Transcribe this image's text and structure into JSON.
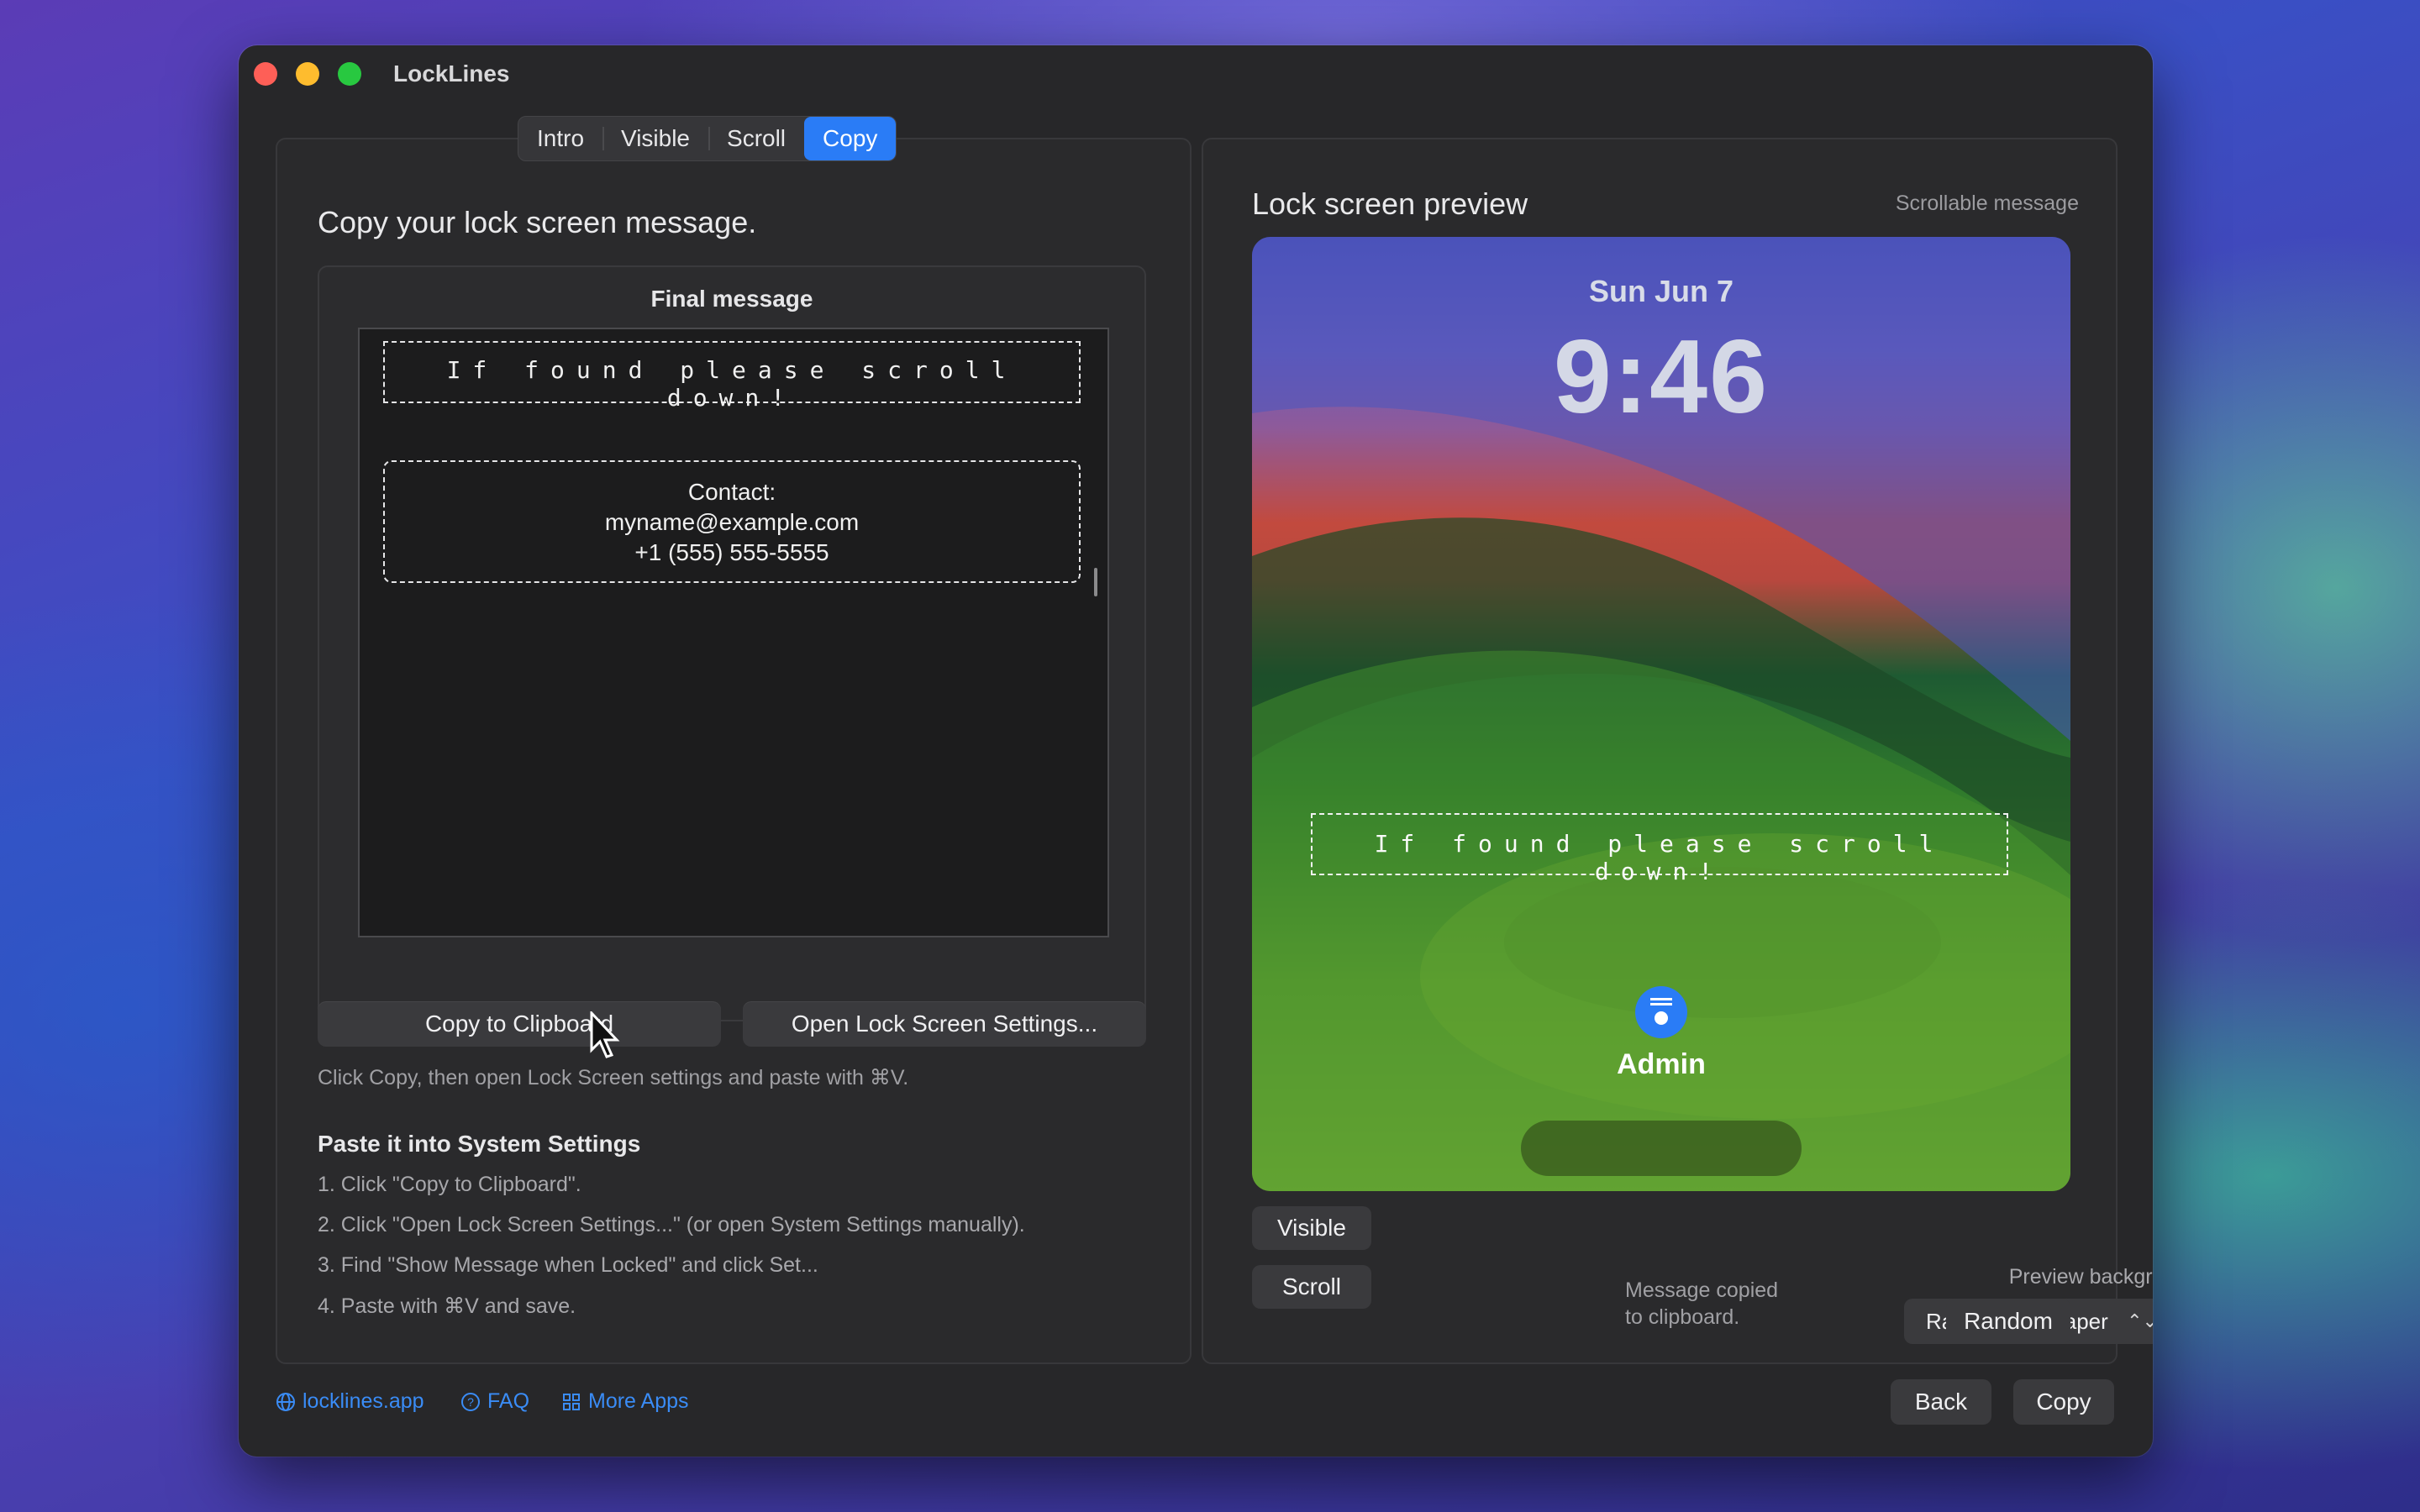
{
  "window": {
    "title": "LockLines"
  },
  "tabs": [
    {
      "label": "Intro",
      "active": false
    },
    {
      "label": "Visible",
      "active": false
    },
    {
      "label": "Scroll",
      "active": false
    },
    {
      "label": "Copy",
      "active": true
    }
  ],
  "left": {
    "heading": "Copy your lock screen message.",
    "box_title": "Final message",
    "message_line": "If found please scroll down!",
    "contact": [
      "Contact:",
      "myname@example.com",
      "+1 (555) 555-5555"
    ],
    "copy_button": "Copy to Clipboard",
    "open_settings_button": "Open Lock Screen Settings...",
    "hint": "Click Copy, then open Lock Screen settings and paste with ⌘V.",
    "paste_title": "Paste it into System Settings",
    "steps": [
      "1. Click \"Copy to Clipboard\".",
      "2. Click \"Open Lock Screen Settings...\" (or open System Settings manually).",
      "3. Find \"Show Message when Locked\" and click Set...",
      "4. Paste with ⌘V and save."
    ]
  },
  "preview": {
    "title": "Lock screen preview",
    "subtitle": "Scrollable message",
    "date": "Sun Jun 7",
    "time": "9:46",
    "message": "If found please scroll down!",
    "user": "Admin",
    "visible_button": "Visible",
    "scroll_button": "Scroll",
    "status": [
      "Message copied",
      "to clipboard."
    ],
    "bg_label": "Preview background",
    "bg_select": "Random wallpaper",
    "random_button": "Random"
  },
  "footer": {
    "site_link": "locklines.app",
    "faq_link": "FAQ",
    "more_apps_link": "More Apps",
    "back_button": "Back",
    "copy_button": "Copy"
  },
  "colors": {
    "accent": "#2a7cf6",
    "window_bg": "#272729"
  }
}
